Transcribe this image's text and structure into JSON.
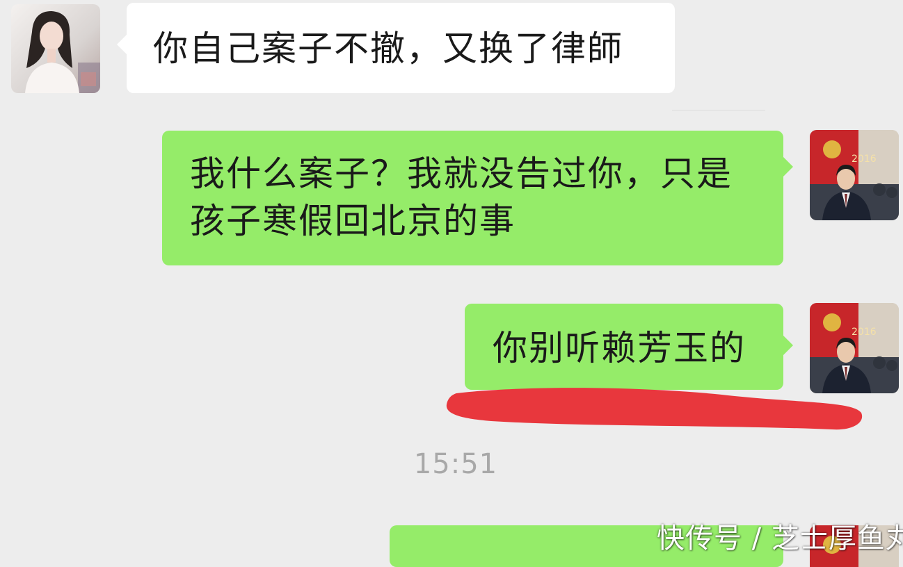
{
  "messages": [
    {
      "sender": "other",
      "text": "你自己案子不撤，又换了律師"
    },
    {
      "sender": "self",
      "line1": "我什么案子？我就没告过你，只是",
      "line2": "孩子寒假回北京的事"
    },
    {
      "sender": "self",
      "text": "你别听赖芳玉的"
    }
  ],
  "timestamp": "15:51",
  "watermark": "快传号 / 芝士厚鱼丸",
  "colors": {
    "background": "#ededed",
    "received_bubble": "#ffffff",
    "sent_bubble": "#95ec69",
    "annotation_mark": "#e8373d"
  },
  "icons": {
    "left_avatar": "contact-avatar-woman",
    "right_avatar": "user-avatar-man-suit"
  }
}
